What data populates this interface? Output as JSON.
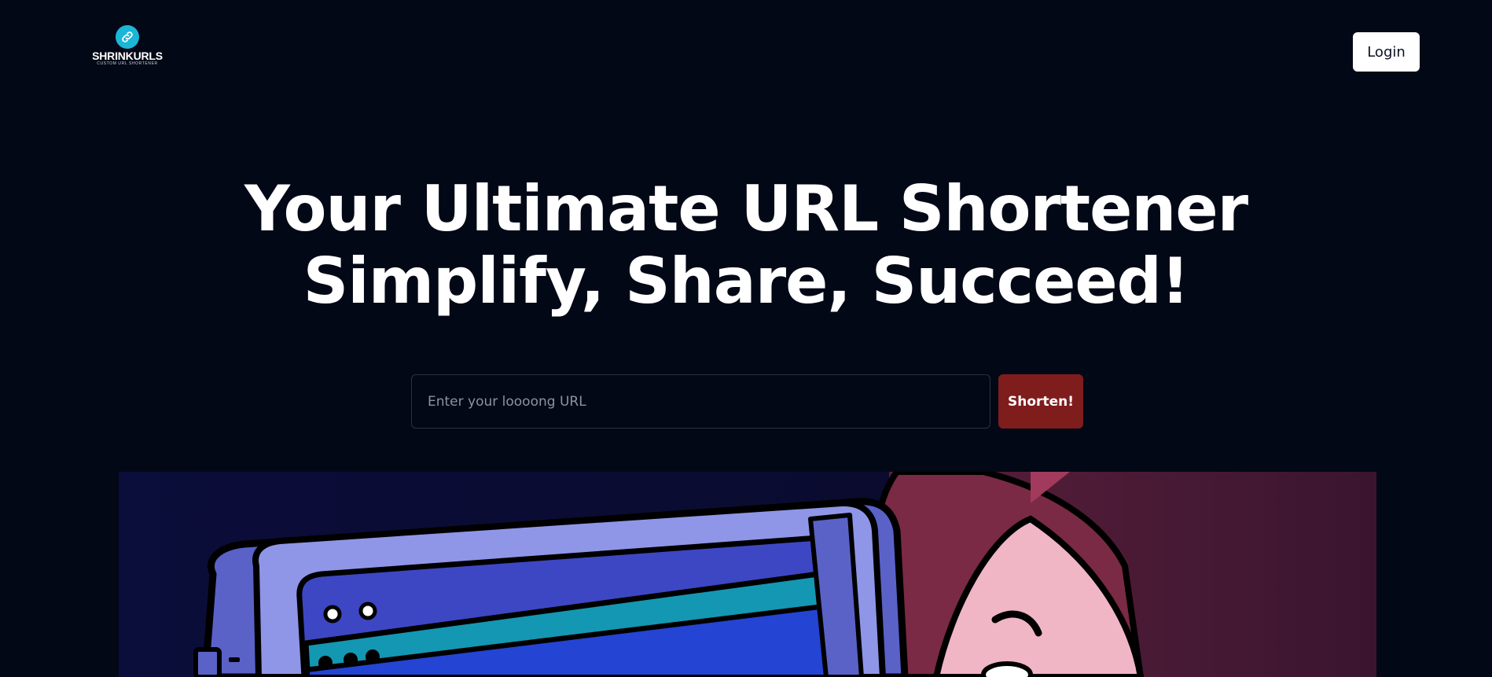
{
  "header": {
    "logo": {
      "name": "SHRINKURLS",
      "tagline": "CUSTOM URL SHORTENER",
      "icon": "link-icon"
    },
    "login_label": "Login"
  },
  "hero": {
    "title_line1": "Your Ultimate URL Shortener",
    "title_line2": "Simplify, Share, Succeed!"
  },
  "form": {
    "url_placeholder": "Enter your loooong URL",
    "url_value": "",
    "submit_label": "Shorten!"
  },
  "colors": {
    "background": "#030816",
    "accent": "#7f1d1d",
    "logo_accent": "#1bb6d8"
  }
}
